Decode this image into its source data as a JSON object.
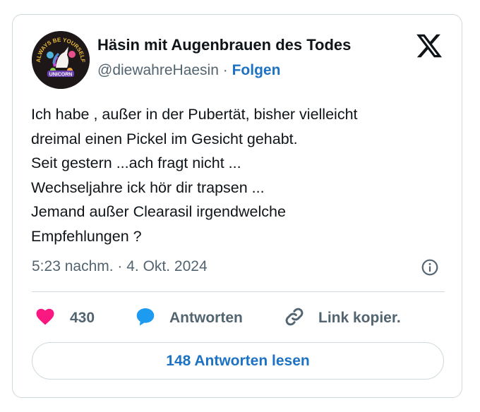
{
  "author": {
    "display_name": "Häsin mit Augenbrauen des Todes",
    "handle": "@diewahreHaesin",
    "separator": "·",
    "follow_label": "Folgen",
    "avatar_text_top": "ALWAYS BE YOURSELF",
    "avatar_text_mid": "UNICORN"
  },
  "tweet": {
    "lines": [
      "Ich habe , außer in der Pubertät, bisher vielleicht",
      "dreimal einen Pickel im Gesicht gehabt.",
      "Seit gestern ...ach fragt nicht ...",
      "Wechseljahre ick hör dir trapsen ...",
      "Jemand außer Clearasil irgendwelche",
      "Empfehlungen ?"
    ],
    "timestamp": "5:23 nachm. · 4. Okt. 2024"
  },
  "actions": {
    "like_count": "430",
    "reply_label": "Antworten",
    "copy_link_label": "Link kopier."
  },
  "read_replies_label": "148 Antworten lesen",
  "colors": {
    "heart": "#f91880",
    "reply_bubble": "#1d9bf0",
    "link_blue": "#1d72c4",
    "muted": "#536471",
    "border": "#cfd9de"
  },
  "icons": [
    "x-logo-icon",
    "info-icon",
    "heart-icon",
    "reply-bubble-icon",
    "link-icon"
  ]
}
